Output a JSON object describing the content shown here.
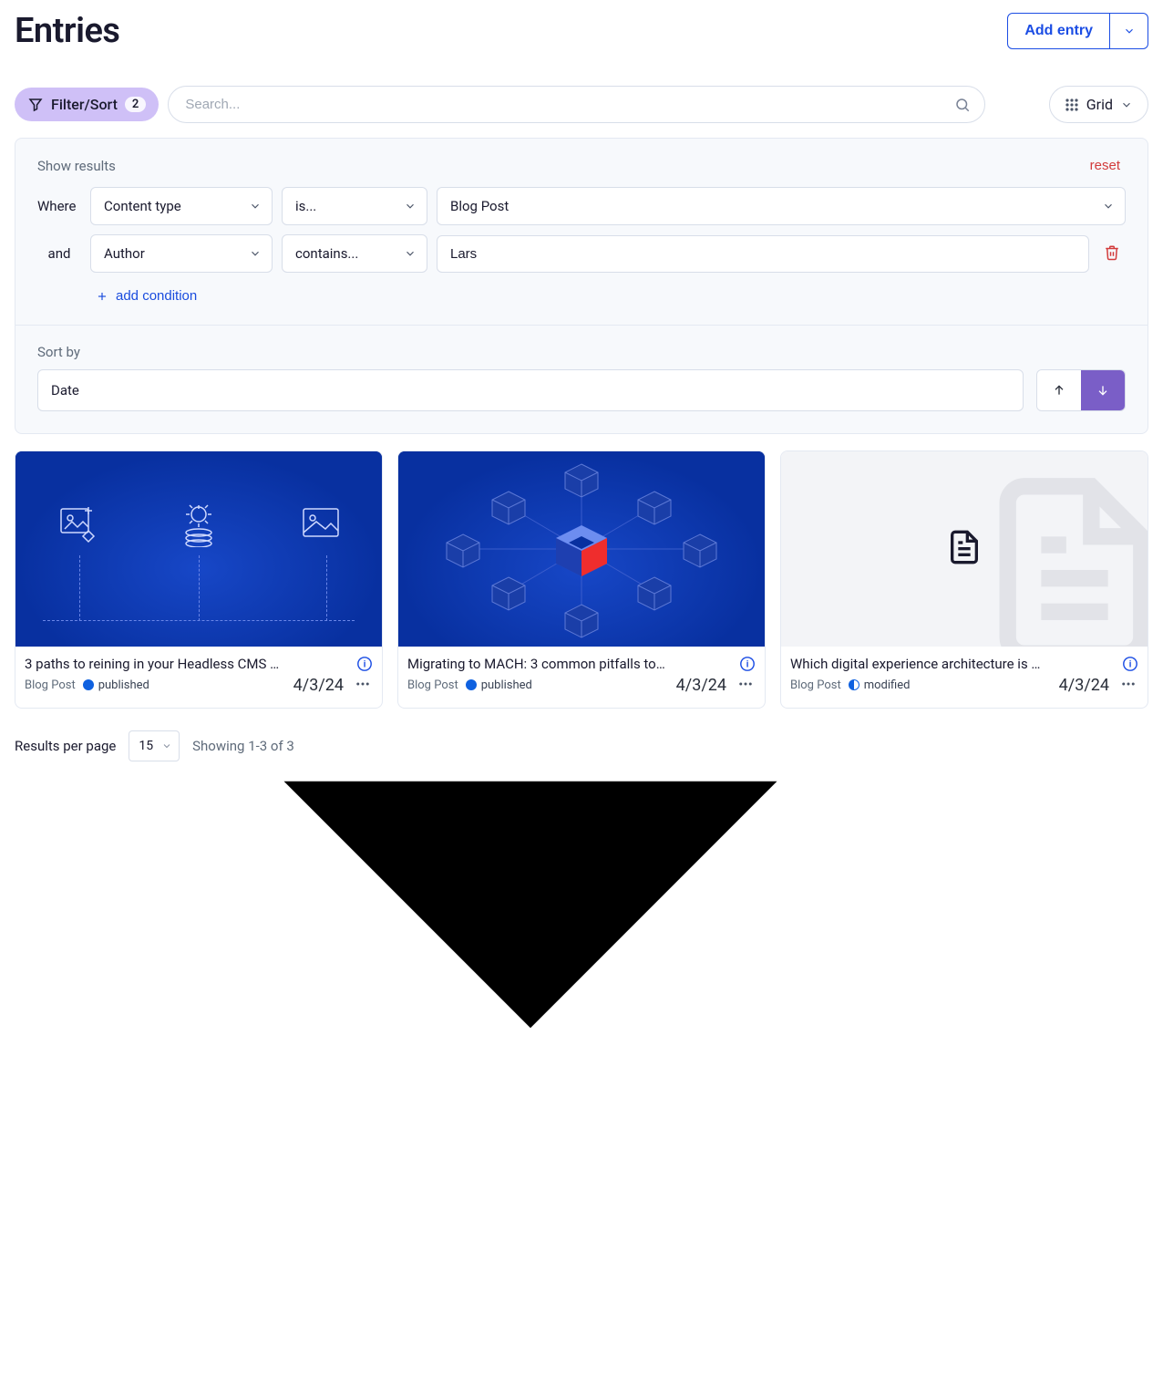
{
  "header": {
    "title": "Entries",
    "add_entry": "Add entry"
  },
  "toolbar": {
    "filter_label": "Filter/Sort",
    "filter_count": "2",
    "search_placeholder": "Search...",
    "view_label": "Grid"
  },
  "filters": {
    "show_results": "Show results",
    "reset": "reset",
    "connectors": [
      "Where",
      "and"
    ],
    "conditions": [
      {
        "field": "Content type",
        "operator": "is...",
        "value": "Blog Post",
        "value_type": "select"
      },
      {
        "field": "Author",
        "operator": "contains...",
        "value": "Lars",
        "value_type": "text"
      }
    ],
    "add_condition": "add condition"
  },
  "sort": {
    "label": "Sort by",
    "field": "Date",
    "direction": "desc"
  },
  "cards": [
    {
      "title": "3 paths to reining in your Headless CMS …",
      "content_type": "Blog Post",
      "status": "published",
      "date": "4/3/24",
      "thumb": "icons"
    },
    {
      "title": "Migrating to MACH: 3 common pitfalls to…",
      "content_type": "Blog Post",
      "status": "published",
      "date": "4/3/24",
      "thumb": "cubes"
    },
    {
      "title": "Which digital experience architecture is …",
      "content_type": "Blog Post",
      "status": "modified",
      "date": "4/3/24",
      "thumb": "placeholder"
    }
  ],
  "footer": {
    "rpp_label": "Results per page",
    "rpp_value": "15",
    "showing": "Showing 1-3 of 3"
  }
}
